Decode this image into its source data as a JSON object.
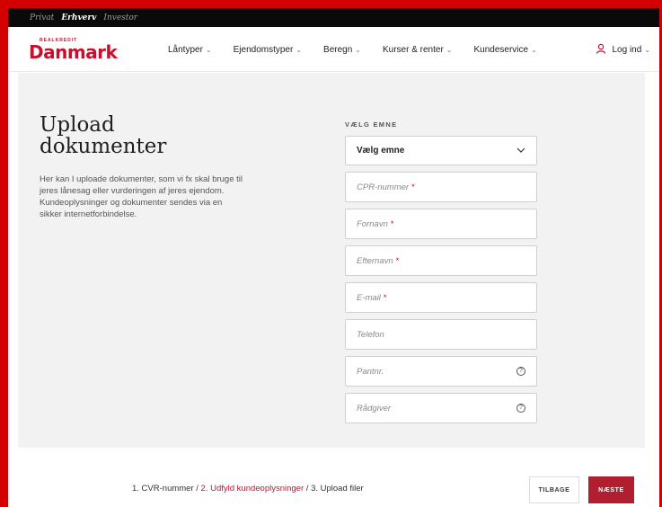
{
  "topbar": {
    "items": [
      {
        "label": "Privat",
        "active": false
      },
      {
        "label": "Erhverv",
        "active": true
      },
      {
        "label": "Investor",
        "active": false
      }
    ]
  },
  "header": {
    "logo_small": "REALKREDIT",
    "logo_big": "Danmark",
    "nav": [
      {
        "label": "Låntyper"
      },
      {
        "label": "Ejendomstyper"
      },
      {
        "label": "Beregn"
      },
      {
        "label": "Kurser & renter"
      },
      {
        "label": "Kundeservice"
      }
    ],
    "login_label": "Log ind"
  },
  "main": {
    "title_line1": "Upload",
    "title_line2": "dokumenter",
    "intro": "Her kan I uploade dokumenter, som vi fx skal bruge til jeres lånesag eller vurderingen af jeres ejendom. Kundeoplysninger og dokumenter sendes via en sikker internetforbindelse.",
    "form": {
      "label": "VÆLG EMNE",
      "select_value": "Vælg emne",
      "fields": [
        {
          "placeholder": "CPR-nummer",
          "required": "*"
        },
        {
          "placeholder": "Fornavn",
          "required": "*"
        },
        {
          "placeholder": "Efternavn",
          "required": "*"
        },
        {
          "placeholder": "E-mail",
          "required": "*"
        },
        {
          "placeholder": "Telefon",
          "required": ""
        },
        {
          "placeholder": "Pantnr.",
          "required": ""
        },
        {
          "placeholder": "Rådgiver",
          "required": ""
        }
      ]
    }
  },
  "footer": {
    "step1": "1. CVR-nummer / ",
    "step2": "2. Udfyld kundeoplysninger",
    "step3": " / 3. Upload filer",
    "back_label": "TILBAGE",
    "next_label": "NÆSTE"
  },
  "colors": {
    "brand_red": "#c8102e",
    "next_button": "#b01e2f",
    "topbar_bg": "#0a0a0a",
    "content_bg": "#f2f2f2"
  }
}
